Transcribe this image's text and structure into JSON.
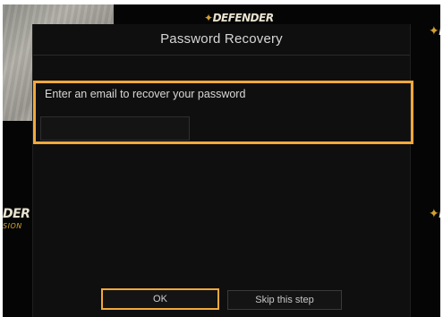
{
  "background": {
    "brand_top": "DEFENDER",
    "brand_left": "DER",
    "brand_left_sub": "SION",
    "brand_right": "D",
    "brand_right_top": "D"
  },
  "dialog": {
    "title": "Password Recovery",
    "email_label": "Enter an email to recover your password",
    "email_value": "",
    "email_placeholder": ""
  },
  "buttons": {
    "ok_label": "OK",
    "skip_label": "Skip this step"
  },
  "colors": {
    "focus_accent": "#f2a93b",
    "background": "#050505",
    "dialog_bg": "#0f0f0f",
    "text": "#d6d6d6"
  }
}
